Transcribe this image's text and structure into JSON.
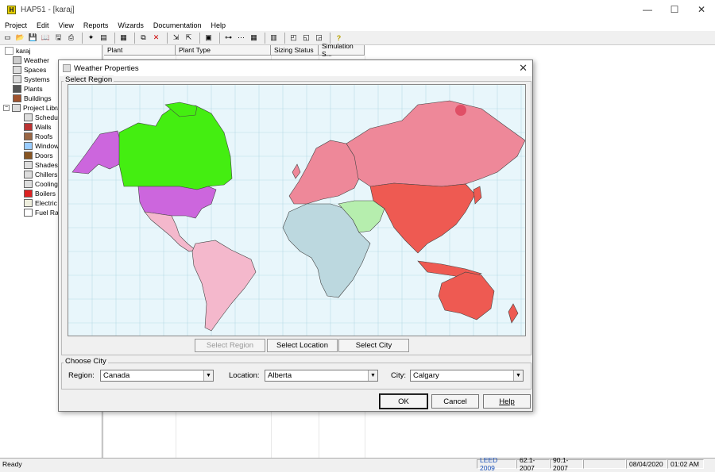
{
  "window": {
    "title": "HAP51 - [karaj]",
    "app_icon": "H"
  },
  "window_buttons": {
    "minimize": "—",
    "maximize": "☐",
    "close": "✕"
  },
  "menu": [
    "Project",
    "Edit",
    "View",
    "Reports",
    "Wizards",
    "Documentation",
    "Help"
  ],
  "toolbar_icons": [
    "new-icon",
    "open-icon",
    "save-icon",
    "book-icon",
    "save-as-icon",
    "print-icon",
    "sep",
    "wizard-icon",
    "report-icon",
    "sep",
    "library-icon",
    "sep",
    "copy-icon",
    "delete-icon",
    "sep",
    "import-icon",
    "export-icon",
    "sep",
    "calc-icon",
    "sep",
    "tree-icon",
    "link-icon",
    "grid-icon",
    "sep",
    "table-icon",
    "sep",
    "chart1-icon",
    "chart2-icon",
    "chart3-icon",
    "sep",
    "help-icon"
  ],
  "tree": {
    "root": "karaj",
    "items": [
      "Weather",
      "Spaces",
      "Systems",
      "Plants",
      "Buildings"
    ],
    "library_label": "Project Libra",
    "library_items": [
      "Schedu",
      "Walls",
      "Roofs",
      "Window",
      "Doors",
      "Shades",
      "Chillers",
      "Cooling",
      "Boilers",
      "Electric",
      "Fuel Ra"
    ]
  },
  "grid": {
    "columns": [
      "Plant",
      "Plant Type",
      "Sizing Status",
      "Simulation S..."
    ]
  },
  "status": {
    "left": "Ready",
    "leed": "LEED 2009",
    "std1": "62.1-2007",
    "std2": "90.1-2007",
    "blank": "",
    "date": "08/04/2020",
    "time": "01:02 AM"
  },
  "dialog": {
    "title": "Weather Properties",
    "close": "✕",
    "select_region_group": "Select Region",
    "tabs": {
      "region": "Select Region",
      "location": "Select Location",
      "city": "Select City"
    },
    "choose_city_group": "Choose City",
    "region_label": "Region:",
    "region_value": "Canada",
    "location_label": "Location:",
    "location_value": "Alberta",
    "city_label": "City:",
    "city_value": "Calgary",
    "ok": "OK",
    "cancel": "Cancel",
    "help": "Help"
  },
  "colors": {
    "ocean": "#e8f6fb",
    "canada": "#44ee11",
    "usa_alaska": "#cc66dd",
    "latin_america": "#f4b8cc",
    "europe_russia": "#ee8899",
    "asia_east": "#ee5a52",
    "africa": "#bcd8df",
    "middle_east": "#b6eeae",
    "australia": "#ee5a52"
  }
}
